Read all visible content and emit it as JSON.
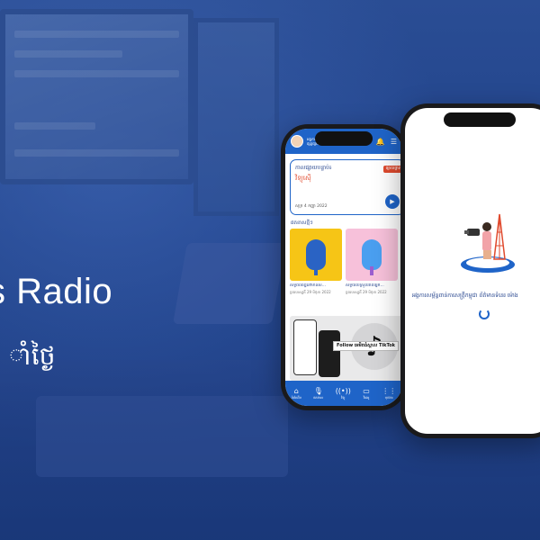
{
  "hero": {
    "headline": "s Radio",
    "subline": "ាំថ្ងៃ"
  },
  "phone_home": {
    "header": {
      "title": "អង្គការសហព័ន្ធប្រព័ន្ធផ្សព្វផ្សាយ",
      "bell_icon": "bell-icon",
      "menu_icon": "menu-icon"
    },
    "now_playing": {
      "title": "កាលផ្សាយបន្ទាប់៖",
      "show": "វិទ្យុស៊ើ",
      "badge": "ផ្សាយផ្ទាល់",
      "date": "សុក្រ 4 កញ្ញា 2022"
    },
    "section_label": "ផតខាសថ្មីៗ",
    "podcasts": [
      {
        "name": "សិទ្ធិពលរដ្ឋនៅមានសិ...",
        "date": "ច្ចពរហស្បតិ៍ 29 មិថុនា 2022",
        "color": "#f6c516"
      },
      {
        "name": "សិទ្ធិយល់ស្រួលរាលអ្នក...",
        "date": "ច្ចពរហស្បតិ៍ 29 មិថុនា 2022",
        "color": "#f7c1da"
      }
    ],
    "promo": {
      "text": "Follow អេមិតធំស្គាល TikTok",
      "tiktok_icon": "tiktok-icon"
    },
    "tabs": [
      {
        "icon": "⌂",
        "label": "ទំព័រដើម"
      },
      {
        "icon": "🎙",
        "label": "ផតខាស"
      },
      {
        "icon": "((•))",
        "label": "វិទ្យុ"
      },
      {
        "icon": "▭",
        "label": "វីដេអូ"
      },
      {
        "icon": "⋮⋮",
        "label": "មុខងារ"
      }
    ]
  },
  "phone_splash": {
    "org_text": "អង្គការសម្ព័ន្ធពាន់កាសេត្រ្តីកម្ពុជា ព័ត៌មានទំនេរ ម៉ោង",
    "loading": "loading-spinner"
  },
  "colors": {
    "background": "#1e3f85",
    "app_blue": "#1f64c8",
    "accent_red": "#e04a2e"
  }
}
